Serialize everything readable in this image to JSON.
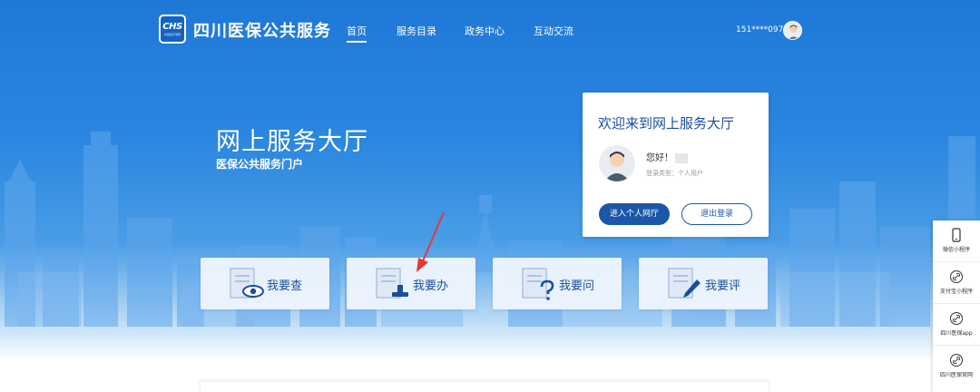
{
  "header": {
    "logo_text": "CHS",
    "logo_subtext": "中国医疗保障",
    "site_title": "四川医保公共服务",
    "nav": [
      {
        "label": "首页",
        "active": true
      },
      {
        "label": "服务目录",
        "active": false
      },
      {
        "label": "政务中心",
        "active": false
      },
      {
        "label": "互动交流",
        "active": false
      }
    ],
    "user_phone": "151****0978"
  },
  "hero": {
    "title": "网上服务大厅",
    "subtitle": "医保公共服务门户"
  },
  "welcome_card": {
    "title": "欢迎来到网上服务大厅",
    "greeting": "您好！",
    "login_type": "登录类型：个人用户",
    "enter_button": "进入个人网厅",
    "logout_button": "退出登录"
  },
  "services": [
    {
      "label": "我要查",
      "icon": "eye-icon"
    },
    {
      "label": "我要办",
      "icon": "stamp-icon"
    },
    {
      "label": "我要问",
      "icon": "question-icon"
    },
    {
      "label": "我要评",
      "icon": "pen-icon"
    }
  ],
  "side_panel": [
    {
      "label": "微信小程序",
      "icon": "phone-icon"
    },
    {
      "label": "支付宝小程序",
      "icon": "link-icon"
    },
    {
      "label": "四川医保app",
      "icon": "link-icon"
    },
    {
      "label": "四川医保官网",
      "icon": "link-icon"
    }
  ],
  "colors": {
    "primary": "#1a57a8",
    "hero_blue": "#2a86e0",
    "annotation_red": "#e53935"
  }
}
